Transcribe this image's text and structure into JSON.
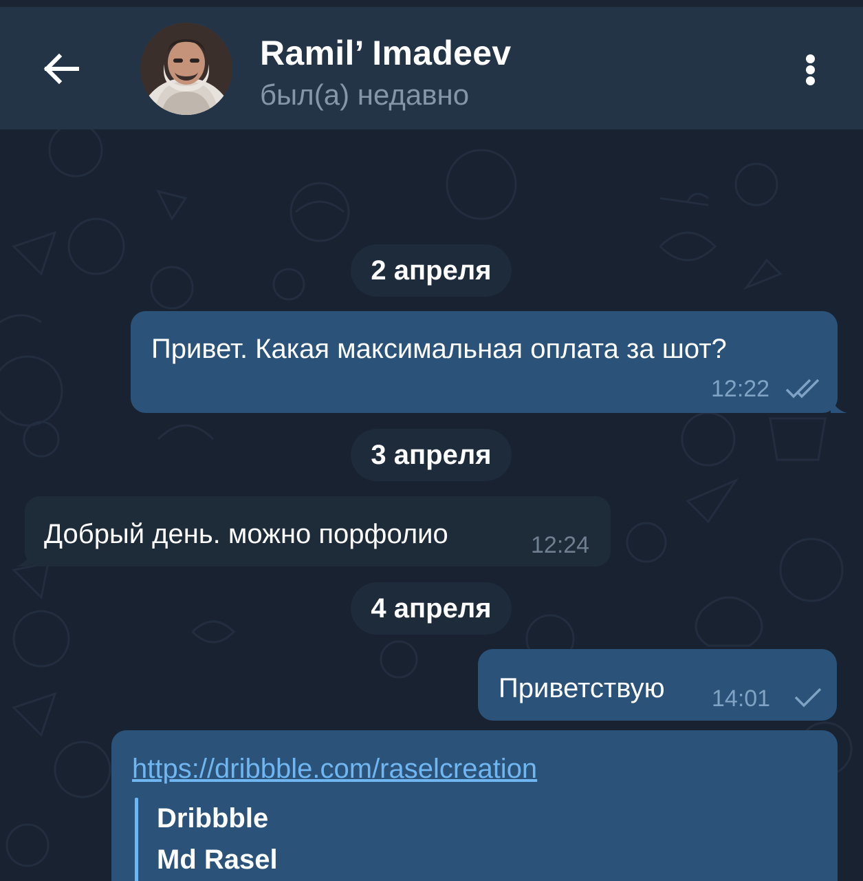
{
  "header": {
    "contact_name": "Ramil’ Imadeev",
    "contact_status": "был(а) недавно",
    "back_icon": "arrow-left-icon",
    "menu_icon": "more-vertical-icon"
  },
  "colors": {
    "header_bg": "#243447",
    "chat_bg": "#192230",
    "outgoing_bubble": "#2b5278",
    "incoming_bubble": "#1e2c3a",
    "link": "#70b6f1",
    "status_text": "#8596a8"
  },
  "messages": [
    {
      "date_separator": "2 апреля"
    },
    {
      "direction": "outgoing",
      "text": "Привет. Какая максимальная оплата за шот?",
      "time": "12:22",
      "status": "read",
      "status_icon": "double-check-icon"
    },
    {
      "date_separator": "3 апреля"
    },
    {
      "direction": "incoming",
      "text": "Добрый день. можно порфолио",
      "time": "12:24"
    },
    {
      "date_separator": "4 апреля"
    },
    {
      "direction": "outgoing",
      "text": "Приветствую",
      "time": "14:01",
      "status": "sent",
      "status_icon": "single-check-icon"
    },
    {
      "direction": "outgoing",
      "link": "https://dribbble.com/raselcreation",
      "preview": {
        "site_name": "Dribbble",
        "title": "Md Rasel"
      }
    }
  ]
}
